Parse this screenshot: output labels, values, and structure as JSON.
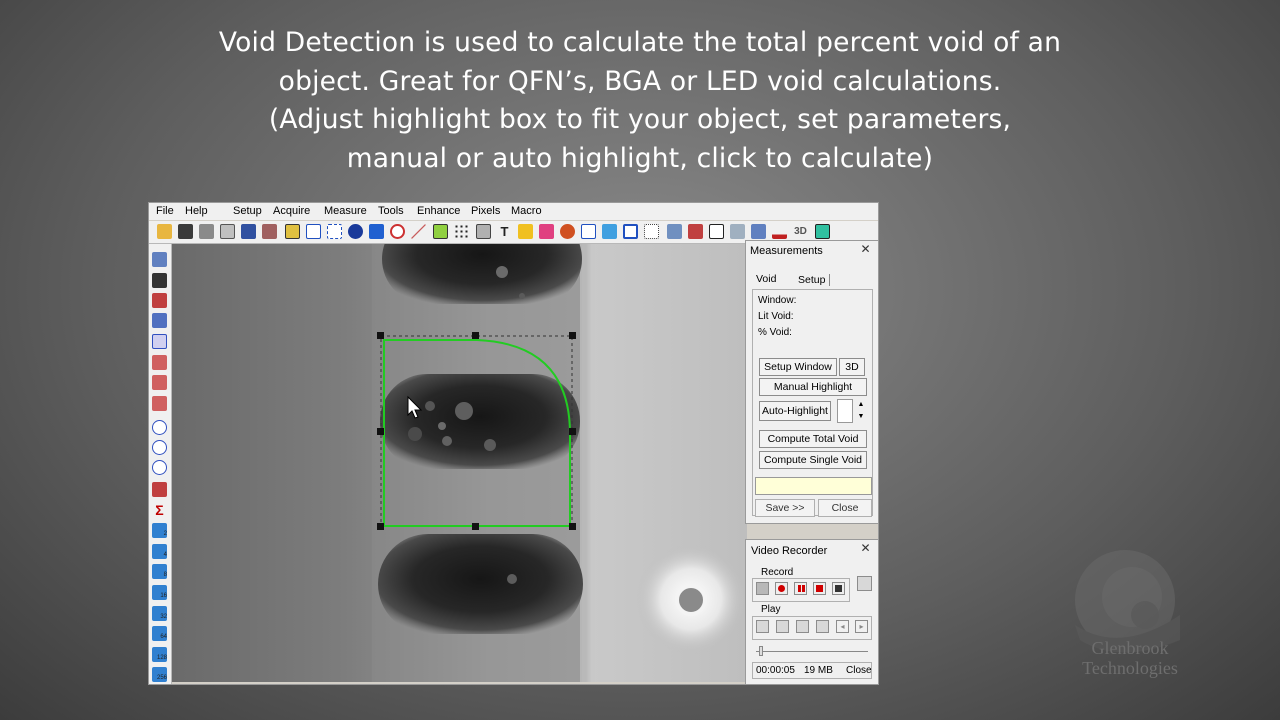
{
  "caption": {
    "line1": "Void Detection is used to calculate the total percent void of an",
    "line2": "object. Great for QFN’s, BGA or LED void calculations.",
    "line3": "(Adjust highlight box to fit your object, set parameters,",
    "line4": "manual or auto highlight, click to calculate)"
  },
  "menu": [
    "File",
    "Help",
    "Setup",
    "Acquire",
    "Measure",
    "Tools",
    "Enhance",
    "Pixels",
    "Macro"
  ],
  "toolbar": {
    "label_3d": "3D"
  },
  "left_tools": {
    "z2": "2",
    "z4": "4",
    "z8": "8",
    "z16": "16",
    "z32": "32",
    "z64": "64",
    "z128": "128",
    "z256": "256"
  },
  "measurements": {
    "title": "Measurements",
    "tabs": [
      "Void",
      "Setup"
    ],
    "fields": {
      "window": "Window:",
      "lit_void": "Lit Void:",
      "pct_void": "% Void:"
    },
    "buttons": {
      "setup_window": "Setup Window",
      "three_d": "3D",
      "manual_highlight": "Manual Highlight",
      "auto_highlight": "Auto-Highlight",
      "compute_total": "Compute Total Void",
      "compute_single": "Compute Single Void",
      "save": "Save >>",
      "close": "Close"
    },
    "colors": {
      "result_box": "#ffffd8"
    }
  },
  "video_recorder": {
    "title": "Video Recorder",
    "record_label": "Record",
    "play_label": "Play",
    "time": "00:00:05",
    "size": "19 MB",
    "close": "Close",
    "colors": {
      "record": "#d00000",
      "pause": "#d00000",
      "stop": "#d00000"
    }
  },
  "watermark": {
    "line1": "Glenbrook",
    "line2": "Technologies"
  },
  "colors": {
    "selection": "#22cc22"
  }
}
